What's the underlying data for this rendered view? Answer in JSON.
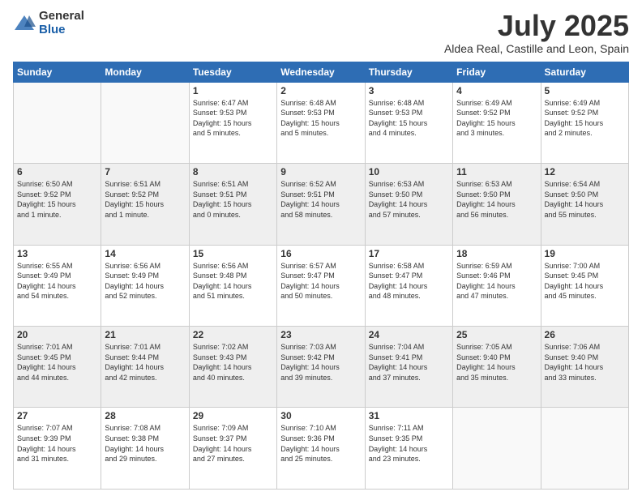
{
  "logo": {
    "general": "General",
    "blue": "Blue"
  },
  "title": "July 2025",
  "subtitle": "Aldea Real, Castille and Leon, Spain",
  "headers": [
    "Sunday",
    "Monday",
    "Tuesday",
    "Wednesday",
    "Thursday",
    "Friday",
    "Saturday"
  ],
  "weeks": [
    [
      {
        "day": "",
        "info": ""
      },
      {
        "day": "",
        "info": ""
      },
      {
        "day": "1",
        "info": "Sunrise: 6:47 AM\nSunset: 9:53 PM\nDaylight: 15 hours\nand 5 minutes."
      },
      {
        "day": "2",
        "info": "Sunrise: 6:48 AM\nSunset: 9:53 PM\nDaylight: 15 hours\nand 5 minutes."
      },
      {
        "day": "3",
        "info": "Sunrise: 6:48 AM\nSunset: 9:53 PM\nDaylight: 15 hours\nand 4 minutes."
      },
      {
        "day": "4",
        "info": "Sunrise: 6:49 AM\nSunset: 9:52 PM\nDaylight: 15 hours\nand 3 minutes."
      },
      {
        "day": "5",
        "info": "Sunrise: 6:49 AM\nSunset: 9:52 PM\nDaylight: 15 hours\nand 2 minutes."
      }
    ],
    [
      {
        "day": "6",
        "info": "Sunrise: 6:50 AM\nSunset: 9:52 PM\nDaylight: 15 hours\nand 1 minute."
      },
      {
        "day": "7",
        "info": "Sunrise: 6:51 AM\nSunset: 9:52 PM\nDaylight: 15 hours\nand 1 minute."
      },
      {
        "day": "8",
        "info": "Sunrise: 6:51 AM\nSunset: 9:51 PM\nDaylight: 15 hours\nand 0 minutes."
      },
      {
        "day": "9",
        "info": "Sunrise: 6:52 AM\nSunset: 9:51 PM\nDaylight: 14 hours\nand 58 minutes."
      },
      {
        "day": "10",
        "info": "Sunrise: 6:53 AM\nSunset: 9:50 PM\nDaylight: 14 hours\nand 57 minutes."
      },
      {
        "day": "11",
        "info": "Sunrise: 6:53 AM\nSunset: 9:50 PM\nDaylight: 14 hours\nand 56 minutes."
      },
      {
        "day": "12",
        "info": "Sunrise: 6:54 AM\nSunset: 9:50 PM\nDaylight: 14 hours\nand 55 minutes."
      }
    ],
    [
      {
        "day": "13",
        "info": "Sunrise: 6:55 AM\nSunset: 9:49 PM\nDaylight: 14 hours\nand 54 minutes."
      },
      {
        "day": "14",
        "info": "Sunrise: 6:56 AM\nSunset: 9:49 PM\nDaylight: 14 hours\nand 52 minutes."
      },
      {
        "day": "15",
        "info": "Sunrise: 6:56 AM\nSunset: 9:48 PM\nDaylight: 14 hours\nand 51 minutes."
      },
      {
        "day": "16",
        "info": "Sunrise: 6:57 AM\nSunset: 9:47 PM\nDaylight: 14 hours\nand 50 minutes."
      },
      {
        "day": "17",
        "info": "Sunrise: 6:58 AM\nSunset: 9:47 PM\nDaylight: 14 hours\nand 48 minutes."
      },
      {
        "day": "18",
        "info": "Sunrise: 6:59 AM\nSunset: 9:46 PM\nDaylight: 14 hours\nand 47 minutes."
      },
      {
        "day": "19",
        "info": "Sunrise: 7:00 AM\nSunset: 9:45 PM\nDaylight: 14 hours\nand 45 minutes."
      }
    ],
    [
      {
        "day": "20",
        "info": "Sunrise: 7:01 AM\nSunset: 9:45 PM\nDaylight: 14 hours\nand 44 minutes."
      },
      {
        "day": "21",
        "info": "Sunrise: 7:01 AM\nSunset: 9:44 PM\nDaylight: 14 hours\nand 42 minutes."
      },
      {
        "day": "22",
        "info": "Sunrise: 7:02 AM\nSunset: 9:43 PM\nDaylight: 14 hours\nand 40 minutes."
      },
      {
        "day": "23",
        "info": "Sunrise: 7:03 AM\nSunset: 9:42 PM\nDaylight: 14 hours\nand 39 minutes."
      },
      {
        "day": "24",
        "info": "Sunrise: 7:04 AM\nSunset: 9:41 PM\nDaylight: 14 hours\nand 37 minutes."
      },
      {
        "day": "25",
        "info": "Sunrise: 7:05 AM\nSunset: 9:40 PM\nDaylight: 14 hours\nand 35 minutes."
      },
      {
        "day": "26",
        "info": "Sunrise: 7:06 AM\nSunset: 9:40 PM\nDaylight: 14 hours\nand 33 minutes."
      }
    ],
    [
      {
        "day": "27",
        "info": "Sunrise: 7:07 AM\nSunset: 9:39 PM\nDaylight: 14 hours\nand 31 minutes."
      },
      {
        "day": "28",
        "info": "Sunrise: 7:08 AM\nSunset: 9:38 PM\nDaylight: 14 hours\nand 29 minutes."
      },
      {
        "day": "29",
        "info": "Sunrise: 7:09 AM\nSunset: 9:37 PM\nDaylight: 14 hours\nand 27 minutes."
      },
      {
        "day": "30",
        "info": "Sunrise: 7:10 AM\nSunset: 9:36 PM\nDaylight: 14 hours\nand 25 minutes."
      },
      {
        "day": "31",
        "info": "Sunrise: 7:11 AM\nSunset: 9:35 PM\nDaylight: 14 hours\nand 23 minutes."
      },
      {
        "day": "",
        "info": ""
      },
      {
        "day": "",
        "info": ""
      }
    ]
  ]
}
